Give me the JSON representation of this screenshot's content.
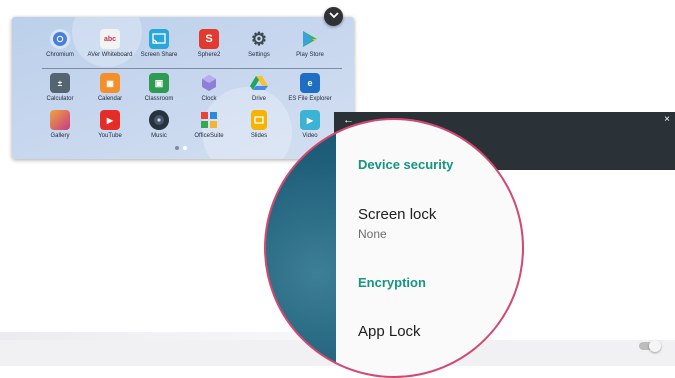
{
  "drawer": {
    "apps_row1": [
      {
        "label": "Chromium",
        "icon": "chromium-icon"
      },
      {
        "label": "AVer Whiteboard",
        "icon": "whiteboard-icon"
      },
      {
        "label": "Screen Share",
        "icon": "cast-icon"
      },
      {
        "label": "Sphere2",
        "icon": "sphere2-icon"
      },
      {
        "label": "Settings",
        "icon": "gear-icon"
      },
      {
        "label": "Play Store",
        "icon": "play-store-icon"
      }
    ],
    "apps_row2": [
      {
        "label": "Calculator",
        "icon": "calculator-icon"
      },
      {
        "label": "Calendar",
        "icon": "calendar-icon"
      },
      {
        "label": "Classroom",
        "icon": "classroom-icon"
      },
      {
        "label": "Clock",
        "icon": "clock-icon"
      },
      {
        "label": "Drive",
        "icon": "drive-icon"
      },
      {
        "label": "ES File Explorer",
        "icon": "file-explorer-icon"
      }
    ],
    "apps_row3": [
      {
        "label": "Gallery",
        "icon": "gallery-icon"
      },
      {
        "label": "YouTube",
        "icon": "youtube-icon"
      },
      {
        "label": "Music",
        "icon": "music-icon"
      },
      {
        "label": "OfficeSuite",
        "icon": "officesuite-icon"
      },
      {
        "label": "Slides",
        "icon": "slides-icon"
      },
      {
        "label": "Video",
        "icon": "video-icon"
      }
    ]
  },
  "settings": {
    "back_glyph": "←",
    "close_glyph": "×",
    "device_security": "Device security",
    "screen_lock": "Screen lock",
    "screen_lock_value": "None",
    "encryption": "Encryption",
    "app_lock": "App Lock"
  },
  "colors": {
    "accent_green": "#16967f",
    "magnifier_ring": "#d7476f",
    "header_dark": "#2b3237"
  }
}
